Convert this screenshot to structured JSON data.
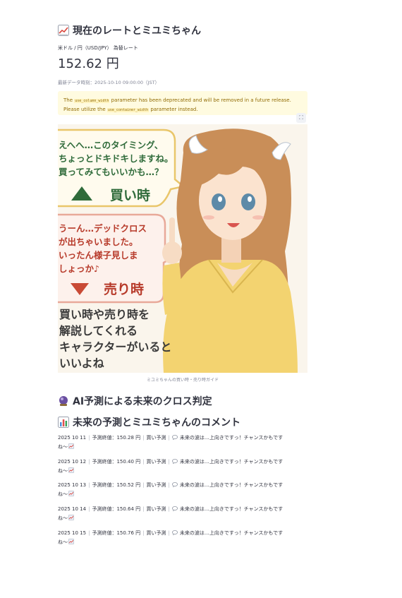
{
  "header": {
    "title": "現在のレートとミユミちゃん",
    "title_icon": "chart-increasing-icon"
  },
  "rate": {
    "label": "米ドル / 円（USD/JPY） 為替レート",
    "value": "152.62 円",
    "timestamp": "最新データ時刻：2025-10-10 09:00:00（JST）"
  },
  "warning": {
    "part1": "The ",
    "code1": "use_column_width",
    "part2": " parameter has been deprecated and will be removed in a future release. Please utilize the ",
    "code2": "use_container_width",
    "part3": " parameter instead."
  },
  "illustration": {
    "buy_bubble": [
      "えへへ…このタイミング、",
      "ちょっとドキドキしますね。",
      "買ってみてもいいかも…？"
    ],
    "buy_label": "買い時",
    "sell_bubble": [
      "うーん…デッドクロス",
      "が出ちゃいました。",
      "いったん様子見しま",
      "しょっか♪"
    ],
    "sell_label": "売り時",
    "bottom_text": [
      "買い時や売り時を",
      "解説してくれる",
      "キャラクターがいると",
      "いいよね"
    ],
    "caption": "ミユミちゃんの買い時・売り時ガイド"
  },
  "sections": {
    "ai_cross": "AI予測による未来のクロス判定",
    "ai_cross_icon": "crystal-ball-icon",
    "future": "未来の予測とミユミちゃんのコメント",
    "future_icon": "bar-chart-icon"
  },
  "predictions": [
    {
      "date": "2025 10 11",
      "close": "予測終値：150.28 円",
      "signal": "買い予測",
      "comment": "未来の波は…上向きですっ！チャンスかもです",
      "tail": "ね〜"
    },
    {
      "date": "2025 10 12",
      "close": "予測終値：150.40 円",
      "signal": "買い予測",
      "comment": "未来の波は…上向きですっ！チャンスかもです",
      "tail": "ね〜"
    },
    {
      "date": "2025 10 13",
      "close": "予測終値：150.52 円",
      "signal": "買い予測",
      "comment": "未来の波は…上向きですっ！チャンスかもです",
      "tail": "ね〜"
    },
    {
      "date": "2025 10 14",
      "close": "予測終値：150.64 円",
      "signal": "買い予測",
      "comment": "未来の波は…上向きですっ！チャンスかもです",
      "tail": "ね〜"
    },
    {
      "date": "2025 10 15",
      "close": "予測終値：150.76 円",
      "signal": "買い予測",
      "comment": "未来の波は…上向きですっ！チャンスかもです",
      "tail": "ね〜"
    }
  ],
  "colors": {
    "warning_bg": "#fffbe0",
    "warning_text": "#926c05",
    "buy_green": "#2f6b3a",
    "sell_red": "#b73a2a"
  }
}
